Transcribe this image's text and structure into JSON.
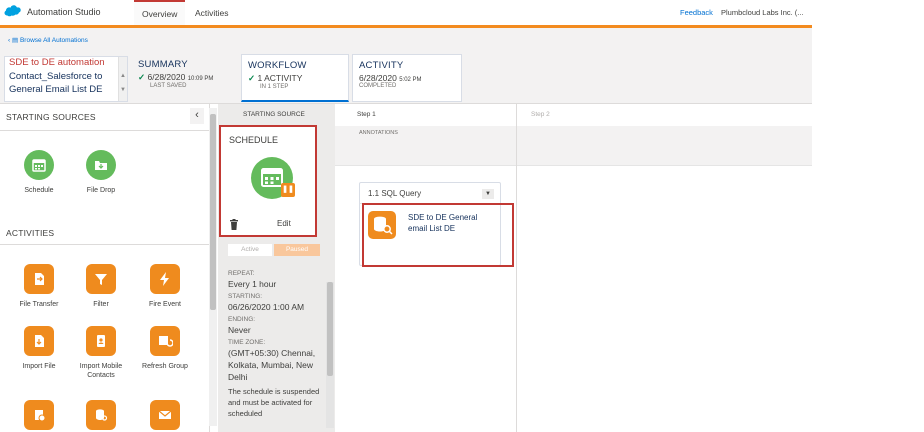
{
  "app": {
    "title": "Automation Studio"
  },
  "tabs": [
    {
      "label": "Overview",
      "active": true
    },
    {
      "label": "Activities",
      "active": false
    }
  ],
  "top_right": {
    "feedback": "Feedback",
    "org": "Plumbcloud Labs Inc. (..."
  },
  "header": {
    "browse": "Browse All Automations",
    "name_lines": [
      "SDE to DE automation",
      "Contact_Salesforce to",
      "General Email List DE"
    ],
    "summary": {
      "title": "SUMMARY",
      "date": "6/28/2020",
      "time": "10:09 PM",
      "sub": "LAST SAVED"
    },
    "workflow": {
      "title": "WORKFLOW",
      "main": "1 ACTIVITY",
      "sub": "IN 1 STEP"
    },
    "activity": {
      "title": "ACTIVITY",
      "date": "6/28/2020",
      "time": "5:02 PM",
      "sub": "COMPLETED"
    }
  },
  "left_panel": {
    "starting_sources_title": "STARTING SOURCES",
    "sources": [
      {
        "label": "Schedule",
        "icon": "calendar-icon"
      },
      {
        "label": "File Drop",
        "icon": "folder-icon"
      }
    ],
    "activities_title": "ACTIVITIES",
    "activities": [
      {
        "label": "File Transfer",
        "icon": "file-transfer-icon"
      },
      {
        "label": "Filter",
        "icon": "filter-icon"
      },
      {
        "label": "Fire Event",
        "icon": "bolt-icon"
      },
      {
        "label": "Import File",
        "icon": "import-file-icon"
      },
      {
        "label": "Import Mobile Contacts",
        "icon": "mobile-contacts-icon"
      },
      {
        "label": "Refresh Group",
        "icon": "refresh-group-icon"
      },
      {
        "label": "",
        "icon": "script-icon"
      },
      {
        "label": "",
        "icon": "sql-query-icon"
      },
      {
        "label": "",
        "icon": "email-icon"
      }
    ]
  },
  "source_column": {
    "header": "STARTING SOURCE",
    "schedule_title": "SCHEDULE",
    "edit": "Edit",
    "toggle_active": "Active",
    "toggle_paused": "Paused",
    "details": [
      {
        "key": "REPEAT:",
        "value": "Every 1 hour"
      },
      {
        "key": "STARTING:",
        "value": "06/26/2020 1:00 AM"
      },
      {
        "key": "ENDING:",
        "value": "Never"
      },
      {
        "key": "TIME ZONE:",
        "value": "(GMT+05:30) Chennai, Kolkata, Mumbai, New Delhi"
      }
    ],
    "note": "The schedule is suspended and must be activated for scheduled"
  },
  "canvas": {
    "step1": "Step 1",
    "step2": "Step 2",
    "annotations": "ANNOTATIONS",
    "activity_header": "1.1 SQL Query",
    "activity_name": "SDE to DE General email List DE"
  },
  "colors": {
    "accent": "#f38b1f",
    "green": "#64bb5c",
    "orange": "#ef8b1e",
    "highlight": "#c23934",
    "link": "#0070d2"
  }
}
